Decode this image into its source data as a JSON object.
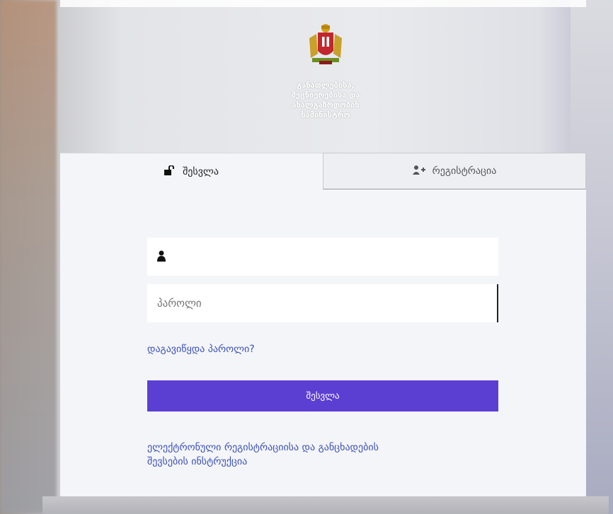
{
  "brand": {
    "ministry_lines": [
      "განათლებისა,",
      "მეცნიერებისა და",
      "ახალგაზრდობის",
      "სამინისტრო"
    ],
    "emblem_icon": "coat-of-arms-icon"
  },
  "tabs": [
    {
      "label": "შესვლა",
      "icon": "unlock-icon",
      "active": true
    },
    {
      "label": "რეგისტრაცია",
      "icon": "user-plus-icon",
      "active": false
    }
  ],
  "form": {
    "username": {
      "value": "",
      "placeholder": "",
      "icon": "user-icon"
    },
    "password": {
      "value": "",
      "placeholder": "პაროლი"
    },
    "forgot_link": "დაგავიწყდა პაროლი?",
    "submit_label": "შესვლა",
    "guide_link_line1": "ელექტრონული რეგისტრაციისა და განცხადების",
    "guide_link_line2": "შევსების ინსტრუქცია"
  },
  "colors": {
    "accent": "#5b3fd3",
    "link": "#3a50b8",
    "panel": "#f4f5f8"
  }
}
